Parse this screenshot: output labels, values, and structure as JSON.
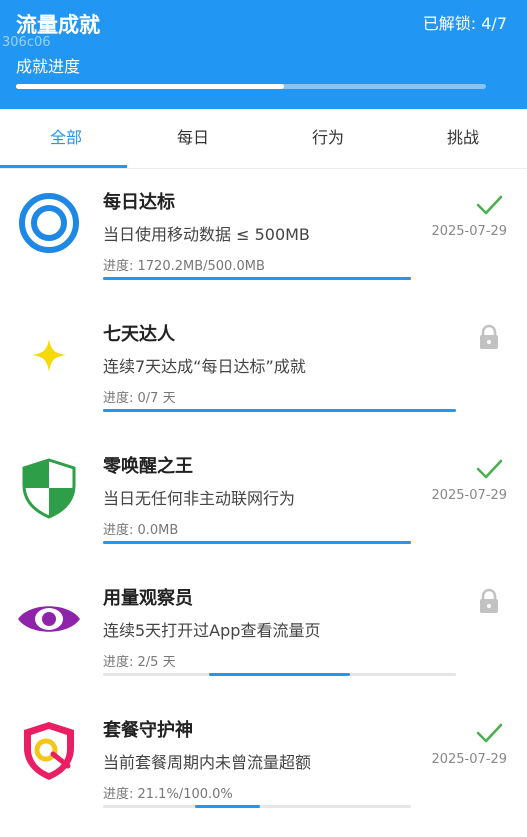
{
  "header": {
    "title": "流量成就",
    "unlocked": "已解锁: 4/7",
    "tag": "306c06",
    "progress_label": "成就进度",
    "progress_fraction": 0.571,
    "bg_color": "#2196F3"
  },
  "tabs": [
    {
      "label": "全部",
      "active": true
    },
    {
      "label": "每日",
      "active": false
    },
    {
      "label": "行为",
      "active": false
    },
    {
      "label": "挑战",
      "active": false
    }
  ],
  "achievements": [
    {
      "title": "每日达标",
      "desc": "当日使用移动数据 ≤ 500MB",
      "progress_text": "进度: 1720.2MB/500.0MB",
      "progress_fraction": 1.0,
      "unlocked": true,
      "date": "2025-07-29",
      "icon": "target-rings-icon"
    },
    {
      "title": "七天达人",
      "desc": "连续7天达成“每日达标”成就",
      "progress_text": "进度: 0/7 天",
      "progress_fraction": 1.0,
      "unlocked": false,
      "date": "",
      "icon": "sparkle-star-icon"
    },
    {
      "title": "零唤醒之王",
      "desc": "当日无任何非主动联网行为",
      "progress_text": "进度: 0.0MB",
      "progress_fraction": 1.0,
      "unlocked": true,
      "date": "2025-07-29",
      "icon": "shield-icon"
    },
    {
      "title": "用量观察员",
      "desc": "连续5天打开过App查看流量页",
      "progress_text": "进度: 2/5 天",
      "progress_fraction": 0.4,
      "unlocked": false,
      "date": "",
      "icon": "eye-icon"
    },
    {
      "title": "套餐守护神",
      "desc": "当前套餐周期内未曾流量超额",
      "progress_text": "进度: 21.1%/100.0%",
      "progress_fraction": 0.211,
      "unlocked": true,
      "date": "2025-07-29",
      "icon": "guard-shield-icon"
    }
  ]
}
